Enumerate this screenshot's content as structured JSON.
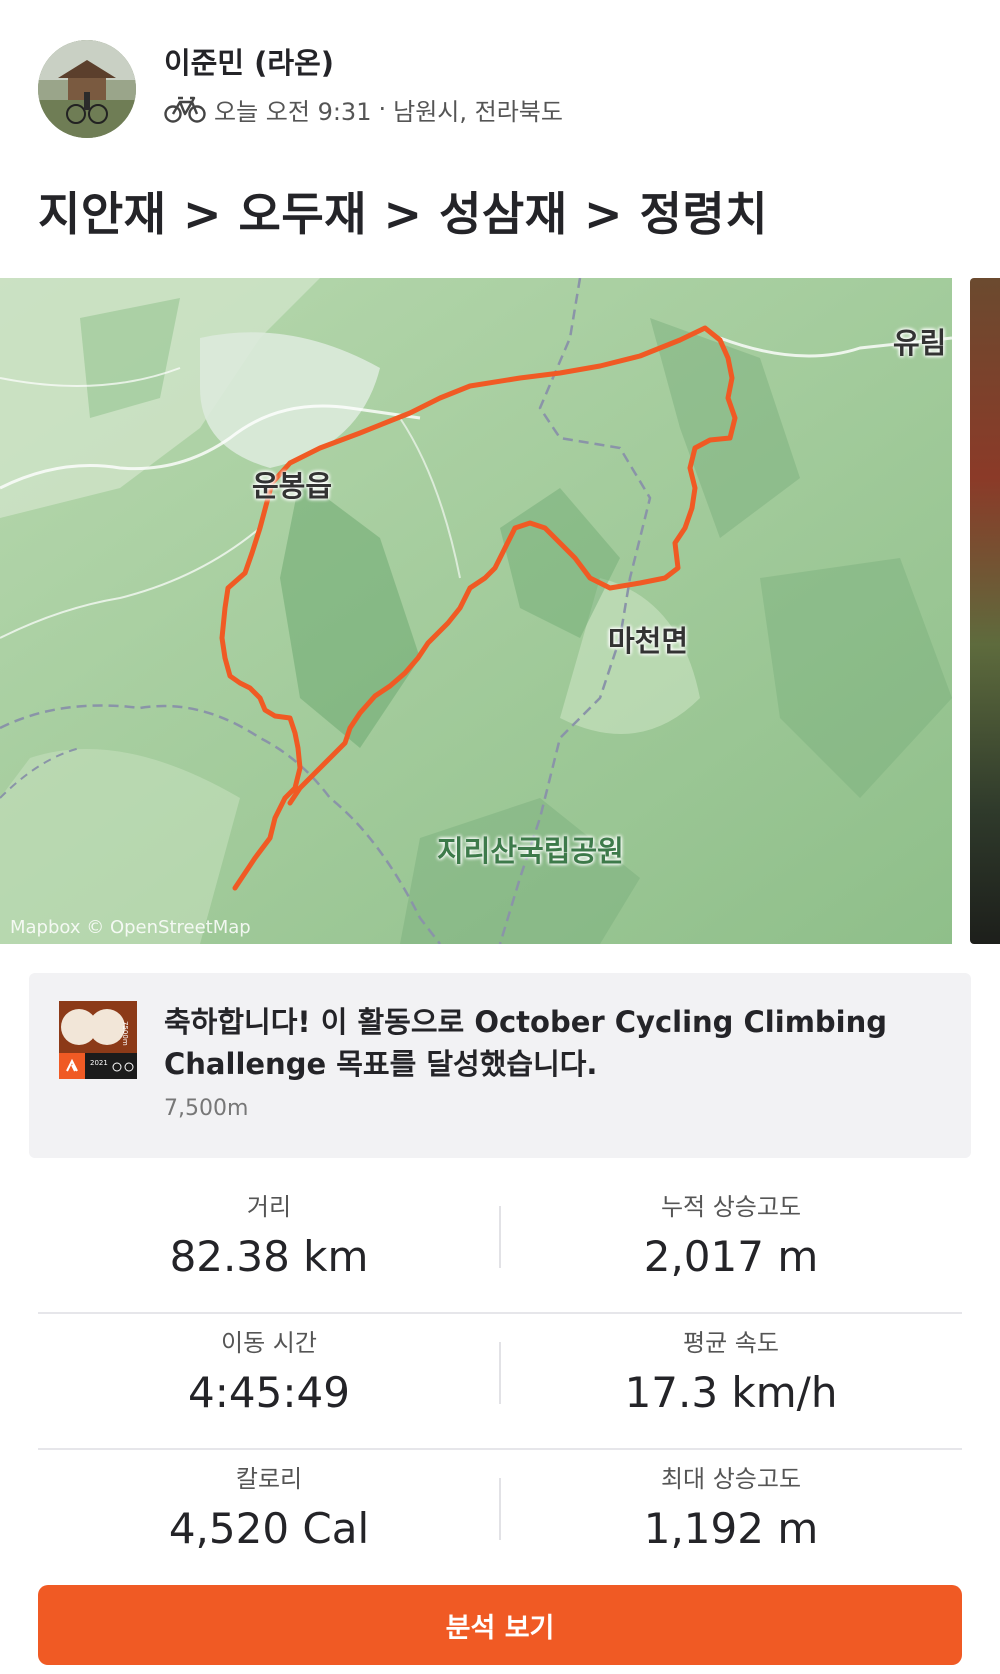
{
  "athlete": {
    "name": "이준민 (라온)",
    "activity_icon": "bicycle-icon",
    "time": "오늘 오전 9:31",
    "separator": "·",
    "location": "남원시, 전라북도"
  },
  "activity": {
    "title": "지안재 > 오두재 > 성삼재 > 정령치"
  },
  "map": {
    "labels": {
      "unbong": "운봉읍",
      "macheon": "마천면",
      "jirisan": "지리산국립공원",
      "yurim": "유림"
    },
    "attribution": "Mapbox © OpenStreetMap",
    "route_color": "#f05a24"
  },
  "achievement": {
    "badge_icon": "challenge-badge-icon",
    "badge_text": "7500m",
    "badge_year": "2021",
    "message": "축하합니다! 이 활동으로 October Cycling Climbing Challenge 목표를 달성했습니다.",
    "sub": "7,500m"
  },
  "stats": [
    {
      "left": {
        "label": "거리",
        "value": "82.38 km"
      },
      "right": {
        "label": "누적 상승고도",
        "value": "2,017 m"
      }
    },
    {
      "left": {
        "label": "이동 시간",
        "value": "4:45:49"
      },
      "right": {
        "label": "평균 속도",
        "value": "17.3 km/h"
      }
    },
    {
      "left": {
        "label": "칼로리",
        "value": "4,520 Cal"
      },
      "right": {
        "label": "최대 상승고도",
        "value": "1,192 m"
      }
    }
  ],
  "cta": {
    "label": "분석 보기"
  },
  "colors": {
    "accent": "#f05a24",
    "map_green": "#a9cfa2"
  }
}
